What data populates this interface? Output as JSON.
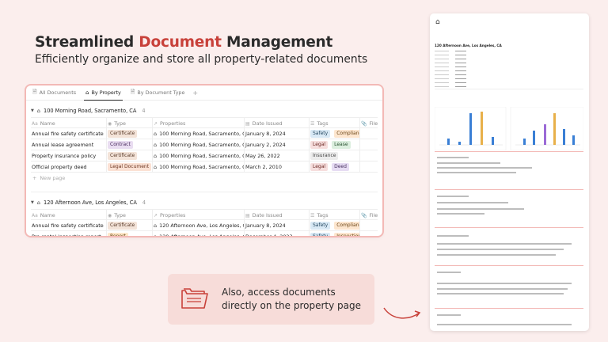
{
  "hero": {
    "title_part1": "Streamlined ",
    "title_accent": "Document",
    "title_part2": " Management",
    "subtitle": "Efficiently organize and store all property-related documents"
  },
  "tabs": [
    {
      "label": "All Documents",
      "icon": "doc-icon",
      "active": false
    },
    {
      "label": "By Property",
      "icon": "house-icon",
      "active": true
    },
    {
      "label": "By Document Type",
      "icon": "doc-icon",
      "active": false
    }
  ],
  "columns": {
    "name": "Name",
    "type": "Type",
    "properties": "Properties",
    "date_issued": "Date Issued",
    "tags": "Tags",
    "file": "File"
  },
  "groups": [
    {
      "title": "100 Morning Road, Sacramento, CA",
      "count": "4",
      "rows": [
        {
          "name": "Annual fire safety certificate",
          "type": "Certificate",
          "type_class": "certificate",
          "property": "100 Morning Road, Sacramento, CA",
          "date": "January 8, 2024",
          "tags": [
            {
              "label": "Safety",
              "class": "safety"
            },
            {
              "label": "Compliance",
              "class": "compliance"
            }
          ]
        },
        {
          "name": "Annual lease agreement",
          "type": "Contract",
          "type_class": "contract",
          "property": "100 Morning Road, Sacramento, CA",
          "date": "January 2, 2024",
          "tags": [
            {
              "label": "Legal",
              "class": "legal"
            },
            {
              "label": "Lease",
              "class": "lease"
            }
          ]
        },
        {
          "name": "Property insurance policy",
          "type": "Certificate",
          "type_class": "certificate",
          "property": "100 Morning Road, Sacramento, CA",
          "date": "May 26, 2022",
          "tags": [
            {
              "label": "Insurance",
              "class": "insurance"
            }
          ]
        },
        {
          "name": "Official property deed",
          "type": "Legal Document",
          "type_class": "legal-document",
          "property": "100 Morning Road, Sacramento, CA",
          "date": "March 2, 2010",
          "tags": [
            {
              "label": "Legal",
              "class": "legal"
            },
            {
              "label": "Deed",
              "class": "deed"
            }
          ]
        }
      ],
      "new_page": "New page"
    },
    {
      "title": "120 Afternoon Ave, Los Angeles, CA",
      "count": "4",
      "rows": [
        {
          "name": "Annual fire safety certificate",
          "type": "Certificate",
          "type_class": "certificate",
          "property": "120 Afternoon Ave, Los Angeles, CA",
          "date": "January 8, 2024",
          "tags": [
            {
              "label": "Safety",
              "class": "safety"
            },
            {
              "label": "Compliance",
              "class": "compliance"
            }
          ]
        },
        {
          "name": "Pre-rental inspection report",
          "type": "Report",
          "type_class": "report",
          "property": "120 Afternoon Ave, Los Angeles, CA",
          "date": "December 4, 2023",
          "tags": [
            {
              "label": "Safety",
              "class": "safety"
            },
            {
              "label": "Inspection",
              "class": "inspection"
            }
          ]
        }
      ]
    }
  ],
  "callout": {
    "line1": "Also, access documents",
    "line2": "directly on the property page"
  },
  "preview": {
    "title": "120 Afternoon Ave, Los Angeles, CA"
  }
}
